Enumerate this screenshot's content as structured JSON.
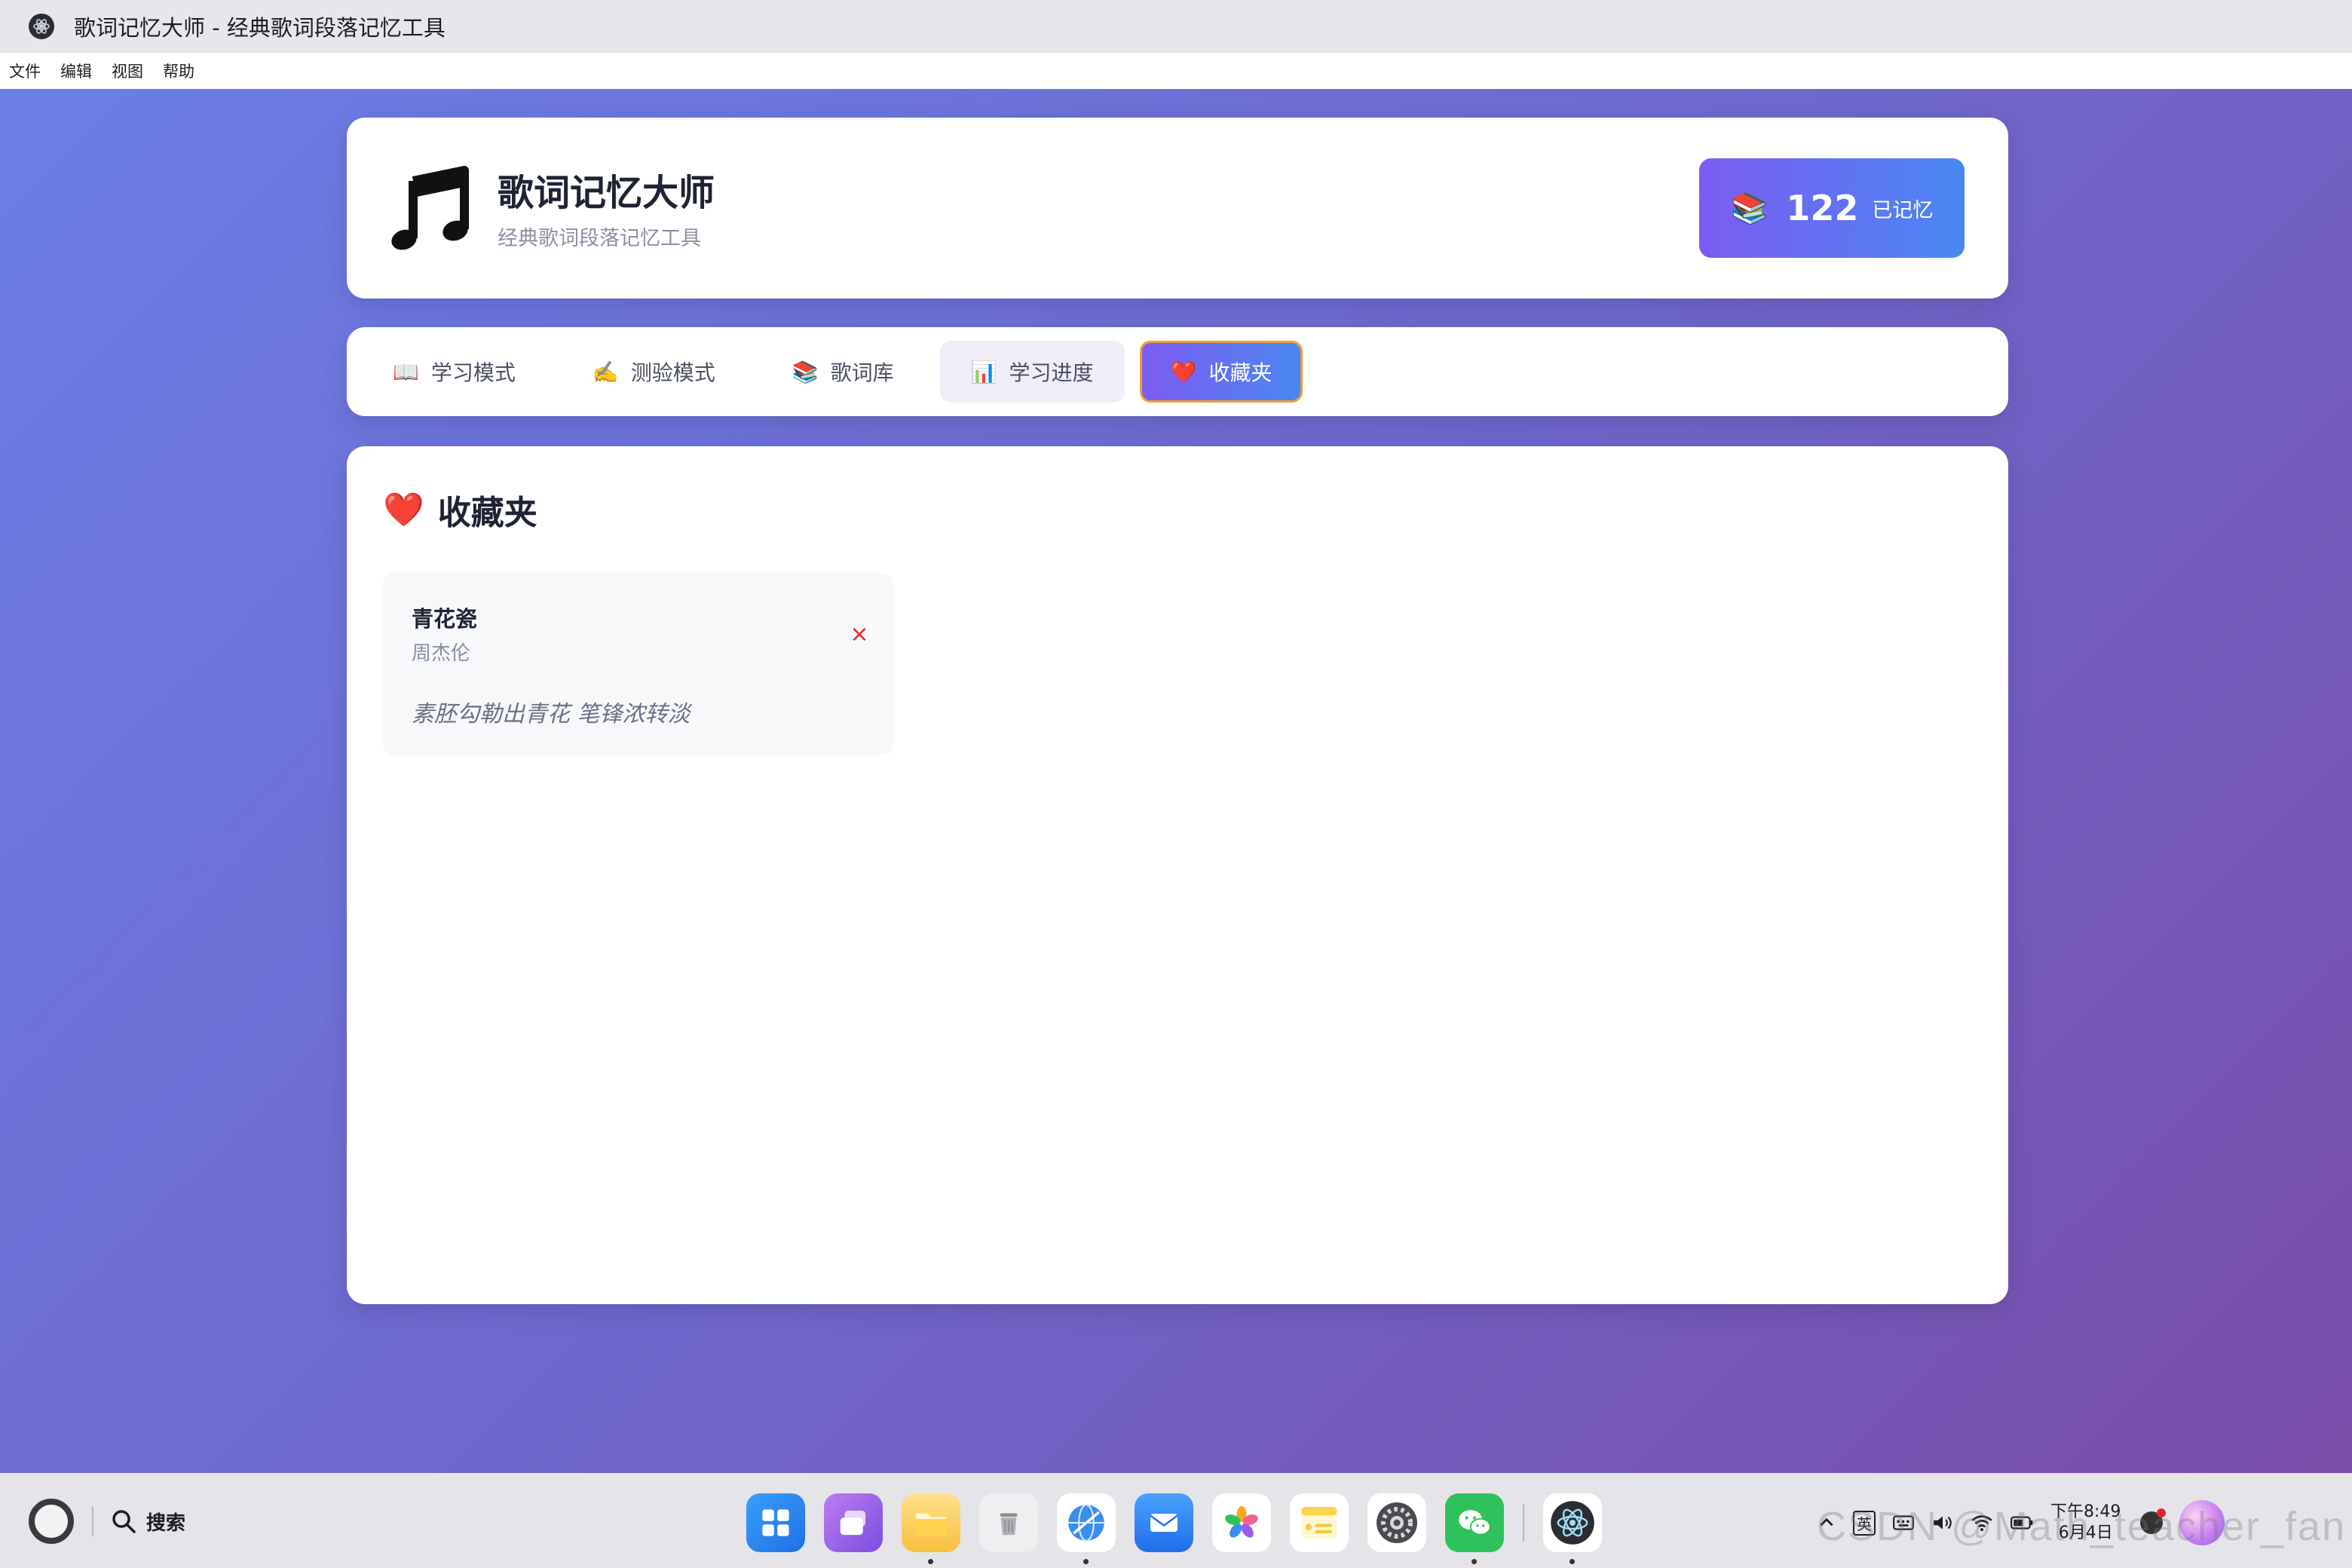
{
  "window": {
    "title": "歌词记忆大师 - 经典歌词段落记忆工具"
  },
  "menu": [
    "文件",
    "编辑",
    "视图",
    "帮助"
  ],
  "header": {
    "icon": "music-note-icon",
    "title": "歌词记忆大师",
    "subtitle": "经典歌词段落记忆工具",
    "stat": {
      "icon": "books-icon",
      "icon_glyph": "📚",
      "value": "122",
      "label": "已记忆"
    }
  },
  "tabs": [
    {
      "icon": "book-icon",
      "glyph": "📖",
      "label": "学习模式",
      "state": "normal"
    },
    {
      "icon": "writing-hand-icon",
      "glyph": "✍️",
      "label": "测验模式",
      "state": "normal"
    },
    {
      "icon": "books-icon",
      "glyph": "📚",
      "label": "歌词库",
      "state": "normal"
    },
    {
      "icon": "bar-chart-icon",
      "glyph": "📊",
      "label": "学习进度",
      "state": "hovered"
    },
    {
      "icon": "heart-icon",
      "glyph": "❤️",
      "label": "收藏夹",
      "state": "active"
    }
  ],
  "favorites": {
    "title_glyph": "❤️",
    "title": "收藏夹",
    "items": [
      {
        "song": "青花瓷",
        "artist": "周杰伦",
        "lyric": "素胚勾勒出青花 笔锋浓转淡",
        "remove": "×"
      }
    ]
  },
  "taskbar": {
    "search_label": "搜索",
    "dock": [
      {
        "name": "launcher-icon",
        "color": "#2f8bf5",
        "running": false
      },
      {
        "name": "multitask-icon",
        "color": "#9b5de5",
        "running": false
      },
      {
        "name": "files-icon",
        "color": "#f7c744",
        "running": true
      },
      {
        "name": "trash-icon",
        "color": "#c8c8cc",
        "running": false
      },
      {
        "name": "browser-icon",
        "color": "#3b8cf0",
        "running": true
      },
      {
        "name": "mail-icon",
        "color": "#2f7df5",
        "running": false
      },
      {
        "name": "photos-icon",
        "color": "#f5f5f5",
        "running": false
      },
      {
        "name": "notes-icon",
        "color": "#f9e07a",
        "running": false
      },
      {
        "name": "settings-icon",
        "color": "#5a5a60",
        "running": false
      },
      {
        "name": "wechat-icon",
        "color": "#2fc25b",
        "running": true
      }
    ],
    "dock_running_app": {
      "name": "electron-app-icon",
      "color": "#2b2d33",
      "running": true
    },
    "tray": {
      "ime": "英",
      "time": "下午8:49",
      "date": "6月4日"
    },
    "watermark": "CSDN @Math_teacher_fan"
  },
  "colors": {
    "accent_start": "#7c5cf2",
    "accent_end": "#4a87f2",
    "active_border": "#f0a030",
    "heart_red": "#e0282c"
  }
}
